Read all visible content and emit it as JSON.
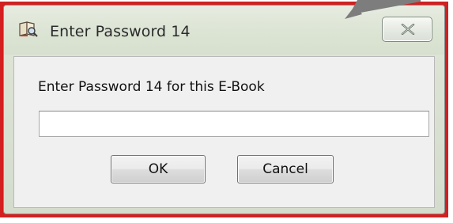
{
  "window": {
    "title": "Enter Password 14",
    "close_icon": "close-x-icon",
    "title_icon": "book-search-icon"
  },
  "dialog": {
    "prompt": "Enter Password 14 for this E-Book",
    "password_value": "",
    "ok_label": "OK",
    "cancel_label": "Cancel"
  },
  "colors": {
    "highlight_frame": "#d21f1f",
    "titlebar": "#dbe3d3",
    "client_bg": "#f0f0f0"
  }
}
